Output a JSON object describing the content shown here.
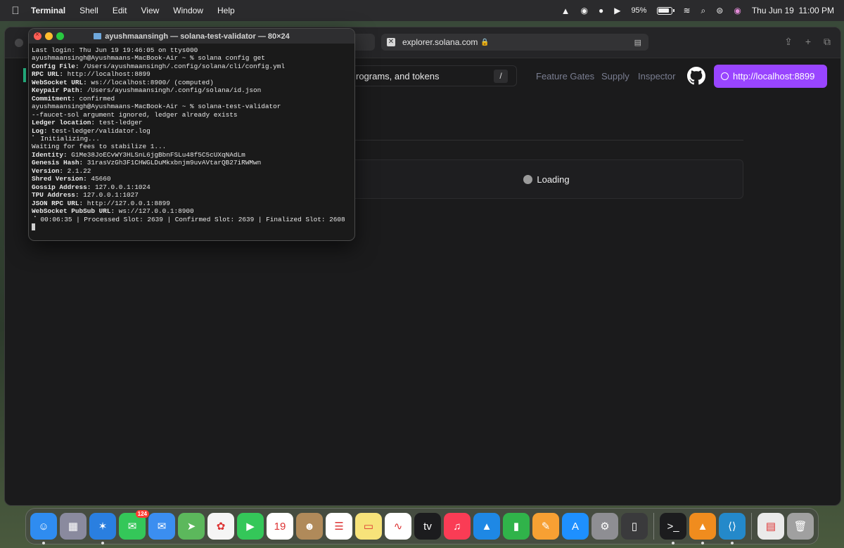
{
  "menubar": {
    "app_name": "Terminal",
    "menus": [
      "Shell",
      "Edit",
      "View",
      "Window",
      "Help"
    ],
    "battery": "95%",
    "datetime": "Thu Jun 19  11:00 PM"
  },
  "browser": {
    "url": "explorer.solana.com",
    "search_placeholder": "rograms, and tokens",
    "search_shortcut": "/",
    "nav_links": [
      "Feature Gates",
      "Supply",
      "Inspector"
    ],
    "cluster_button": "http://localhost:8899",
    "loading_text": "Loading",
    "accent_color": "#9945ff"
  },
  "terminal": {
    "title": "ayushmaansingh — solana-test-validator — 80×24",
    "lines": [
      {
        "k": "",
        "v": "Last login: Thu Jun 19 19:46:05 on ttys000"
      },
      {
        "k": "",
        "v": "ayushmaansingh@Ayushmaans-MacBook-Air ~ % solana config get"
      },
      {
        "k": "Config File:",
        "v": " /Users/ayushmaansingh/.config/solana/cli/config.yml"
      },
      {
        "k": "RPC URL:",
        "v": " http://localhost:8899"
      },
      {
        "k": "WebSocket URL:",
        "v": " ws://localhost:8900/ (computed)"
      },
      {
        "k": "Keypair Path:",
        "v": " /Users/ayushmaansingh/.config/solana/id.json"
      },
      {
        "k": "Commitment:",
        "v": " confirmed"
      },
      {
        "k": "",
        "v": "ayushmaansingh@Ayushmaans-MacBook-Air ~ % solana-test-validator"
      },
      {
        "k": "",
        "v": "--faucet-sol argument ignored, ledger already exists"
      },
      {
        "k": "Ledger location:",
        "v": " test-ledger"
      },
      {
        "k": "Log:",
        "v": " test-ledger/validator.log"
      },
      {
        "k": "",
        "v": "⠁ Initializing..."
      },
      {
        "k": "",
        "v": "Waiting for fees to stabilize 1..."
      },
      {
        "k": "Identity:",
        "v": " G1Me38JoECvWY3HLSnL6jgBbnFSLu48f5C5cUXqNAdLm"
      },
      {
        "k": "Genesis Hash:",
        "v": " 31rasVzGh3F1CHWGLDuMkxbnjm9uvAVtarQB27iRWMwn"
      },
      {
        "k": "Version:",
        "v": " 2.1.22"
      },
      {
        "k": "Shred Version:",
        "v": " 45660"
      },
      {
        "k": "Gossip Address:",
        "v": " 127.0.0.1:1024"
      },
      {
        "k": "TPU Address:",
        "v": " 127.0.0.1:1027"
      },
      {
        "k": "JSON RPC URL:",
        "v": " http://127.0.0.1:8899"
      },
      {
        "k": "WebSocket PubSub URL:",
        "v": " ws://127.0.0.1:8900"
      },
      {
        "k": "",
        "v": "⠈ 00:06:35 | Processed Slot: 2639 | Confirmed Slot: 2639 | Finalized Slot: 2608"
      }
    ]
  },
  "dock": {
    "apps": [
      {
        "name": "finder-icon",
        "glyph": "☺",
        "bg": "#2f8cf0",
        "running": true
      },
      {
        "name": "launchpad-icon",
        "glyph": "▦",
        "bg": "#8a8a9e",
        "running": false
      },
      {
        "name": "safari-icon",
        "glyph": "✶",
        "bg": "#2a7fe0",
        "running": true
      },
      {
        "name": "messages-icon",
        "glyph": "✉",
        "bg": "#34c759",
        "running": false,
        "badge": "124"
      },
      {
        "name": "mail-icon",
        "glyph": "✉",
        "bg": "#3b8ef0",
        "running": false
      },
      {
        "name": "maps-icon",
        "glyph": "➤",
        "bg": "#5cb85c",
        "running": false
      },
      {
        "name": "photos-icon",
        "glyph": "✿",
        "bg": "#f5f5f5",
        "running": false
      },
      {
        "name": "facetime-icon",
        "glyph": "▶",
        "bg": "#34c759",
        "running": false
      },
      {
        "name": "calendar-icon",
        "glyph": "19",
        "bg": "#ffffff",
        "running": false
      },
      {
        "name": "contacts-icon",
        "glyph": "☻",
        "bg": "#b08a5a",
        "running": false
      },
      {
        "name": "reminders-icon",
        "glyph": "☰",
        "bg": "#ffffff",
        "running": false
      },
      {
        "name": "notes-icon",
        "glyph": "▭",
        "bg": "#f7e37a",
        "running": false
      },
      {
        "name": "freeform-icon",
        "glyph": "∿",
        "bg": "#ffffff",
        "running": false
      },
      {
        "name": "apple-tv-icon",
        "glyph": "tv",
        "bg": "#1c1c1e",
        "running": false
      },
      {
        "name": "music-icon",
        "glyph": "♫",
        "bg": "#fa3c55",
        "running": false
      },
      {
        "name": "keynote-icon",
        "glyph": "▲",
        "bg": "#1e88e5",
        "running": false
      },
      {
        "name": "numbers-icon",
        "glyph": "▮",
        "bg": "#30b34a",
        "running": false
      },
      {
        "name": "pages-icon",
        "glyph": "✎",
        "bg": "#f7a033",
        "running": false
      },
      {
        "name": "app-store-icon",
        "glyph": "A",
        "bg": "#1e90ff",
        "running": false
      },
      {
        "name": "system-settings-icon",
        "glyph": "⚙",
        "bg": "#8e8e93",
        "running": false
      },
      {
        "name": "iphone-mirroring-icon",
        "glyph": "▯",
        "bg": "#3a3a3c",
        "running": false
      },
      {
        "name": "terminal-icon",
        "glyph": ">_",
        "bg": "#1c1c1e",
        "running": true,
        "sep_before": true
      },
      {
        "name": "vlc-icon",
        "glyph": "▲",
        "bg": "#f08c1e",
        "running": true
      },
      {
        "name": "vscode-icon",
        "glyph": "⟨⟩",
        "bg": "#2489ca",
        "running": true
      },
      {
        "name": "downloads-stack-icon",
        "glyph": "▤",
        "bg": "#eaeaea",
        "running": false,
        "sep_before": true
      },
      {
        "name": "trash-icon",
        "glyph": "🗑",
        "bg": "#a0a0a0",
        "running": false
      }
    ]
  }
}
